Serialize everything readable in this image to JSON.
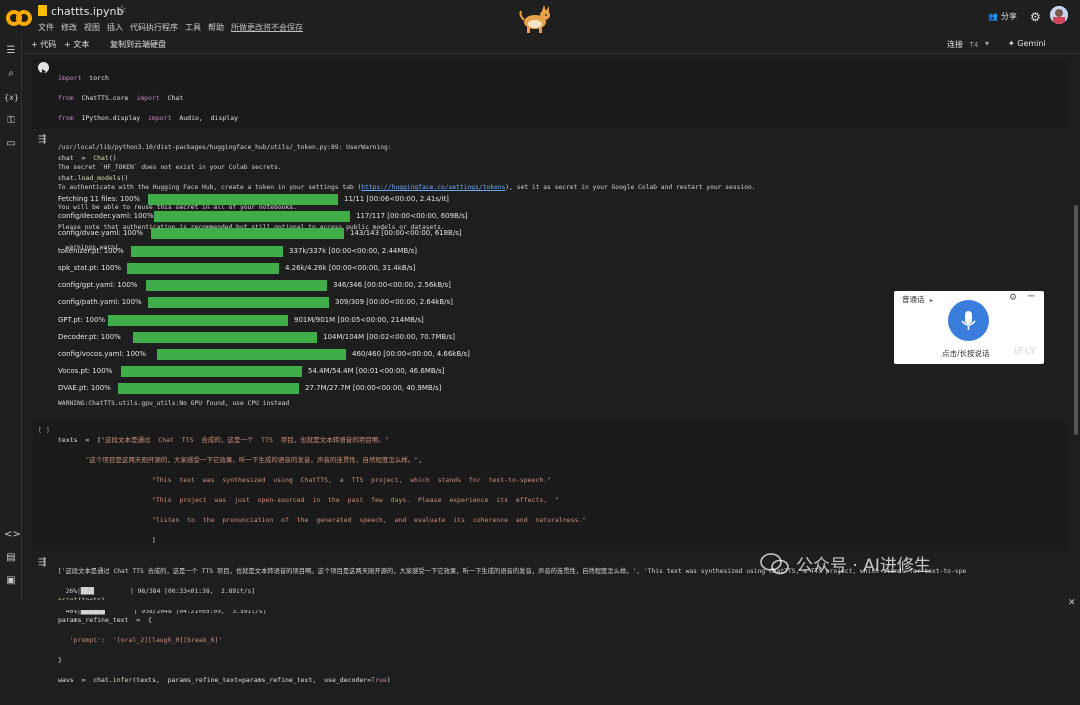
{
  "app": {
    "notebook_title": "chattts.ipynb",
    "menu": [
      "文件",
      "修改",
      "视图",
      "插入",
      "代码执行程序",
      "工具",
      "帮助"
    ],
    "unsaved_notice": "所做更改将不会保存",
    "share_label": "分享"
  },
  "toolbar": {
    "add_code": "+ 代码",
    "add_text": "+ 文本",
    "copy_drive": "复制到云端硬盘",
    "connect_label": "连接",
    "connect_value": "T4",
    "gemini_label": "Gemini"
  },
  "cell1": {
    "lines": [
      "import  torch",
      "from  ChatTTS.core  import  Chat",
      "from  IPython.display  import  Audio,  display",
      "",
      "chat  =  Chat()",
      "chat.load_models()"
    ]
  },
  "output1": {
    "lines": [
      "/usr/local/lib/python3.10/dist-packages/huggingface_hub/utils/_token.py:89: UserWarning:",
      "The secret `HF_TOKEN` does not exist in your Colab secrets.",
      "To authenticate with the Hugging Face Hub, create a token in your settings tab (https://huggingface.co/settings/tokens), set it as secret in your Google Colab and restart your session.",
      "You will be able to reuse this secret in all of your notebooks.",
      "Please note that authentication is recommended but still optional to access public models or datasets.",
      "  warnings.warn("
    ],
    "token_link": "https://huggingface.co/settings/tokens",
    "progress": [
      {
        "label": "Fetching 11 files: 100%",
        "stats": "11/11 [00:06<00:00,   2.41s/it]",
        "fraction": 1.0
      },
      {
        "label": "config/decoder.yaml: 100%",
        "stats": "117/117 [00:00<00:00, 609B/s]",
        "fraction": 1.0
      },
      {
        "label": "config/dvae.yaml: 100%",
        "stats": "143/143 [00:00<00:00, 618B/s]",
        "fraction": 1.0
      },
      {
        "label": "tokenizer.pt: 100%",
        "stats": "337k/337k [00:00<00:00, 2.44MB/s]",
        "fraction": 1.0
      },
      {
        "label": "spk_stat.pt: 100%",
        "stats": "4.26k/4.26k [00:00<00:00, 31.4kB/s]",
        "fraction": 1.0
      },
      {
        "label": "config/gpt.yaml: 100%",
        "stats": "346/346 [00:00<00:00, 2.56kB/s]",
        "fraction": 1.0
      },
      {
        "label": "config/path.yaml: 100%",
        "stats": "309/309 [00:00<00:00, 2.64kB/s]",
        "fraction": 1.0
      },
      {
        "label": "GPT.pt: 100%",
        "stats": "901M/901M [00:05<00:00, 214MB/s]",
        "fraction": 1.0
      },
      {
        "label": "Decoder.pt: 100%",
        "stats": "104M/104M [00:02<00:00, 70.7MB/s]",
        "fraction": 1.0
      },
      {
        "label": "config/vocos.yaml: 100%",
        "stats": "460/460 [00:00<00:00, 4.66kB/s]",
        "fraction": 1.0
      },
      {
        "label": "Vocos.pt: 100%",
        "stats": "54.4M/54.4M [00:01<00:00, 46.6MB/s]",
        "fraction": 1.0
      },
      {
        "label": "DVAE.pt: 100%",
        "stats": "27.7M/27.7M [00:00<00:00, 40.9MB/s]",
        "fraction": 1.0
      }
    ],
    "warning": "WARNING:ChatTTS.utils.gpu_utils:No GPU found, use CPU instead"
  },
  "cell2": {
    "run_marker": "[ ]",
    "lines": [
      "texts  =  [\"这段文本是通过  Chat  TTS  合成的，这是一个  TTS  项目，也就是文本转语音的项目啊。\"",
      "       \"这个项目是这两天刚开源的，大家感受一下它效果，听一下生成的语音的发音，声音的连贯性，自然程度怎么样。\",",
      "                        \"This  text  was  synthesized  using  ChatTTS,  a  TTS  project,  which  stands  for  text-to-speech.\"",
      "                        \"This  project  was  just  open-sourced  in  the  past  few  days.  Please  experience  its  effects,  \"",
      "                        \"listen  to  the  pronunciation  of  the  generated  speech,  and  evaluate  its  coherence  and  naturalness.\"",
      "                        ]",
      "",
      "",
      "print(texts)",
      "params_refine_text  =  {",
      "   'prompt':  '[oral_2][laugh_0][break_6]'",
      "}",
      "wavs  =  chat.infer(texts,  params_refine_text=params_refine_text,  use_decoder=True)"
    ]
  },
  "output2": {
    "lines": [
      "['这段文本是通过 Chat TTS 合成的，这是一个 TTS 项目，也就是文本转语音的项目啊。这个项目是这两天刚开源的，大家感受一下它效果，听一下生成的语音的发音，声音的连贯性，自然程度怎么样。', 'This text was synthesized using ChatTTS, a TTS project, which stands for text-to-spe",
      "  26%|███▌         | 98/384 [00:33<01:38,  2.89it/s]",
      "  46%|██████▍       | 938/2048 [04:21<05:09,  3.59it/s]"
    ]
  },
  "ifly": {
    "title": "普通话",
    "hint": "点击/长按说话",
    "brand": "iFLY"
  },
  "watermark": {
    "text": "公众号 · AI进修生"
  }
}
